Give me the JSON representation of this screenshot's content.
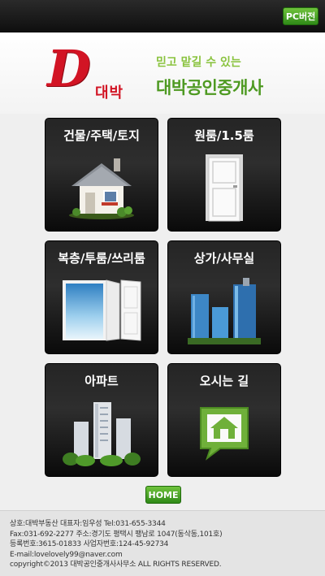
{
  "topbar": {
    "pc_label": "PC버전"
  },
  "header": {
    "logo_letter": "D",
    "logo_word": "대박",
    "tagline": "믿고 맡길 수 있는",
    "company": "대박공인중개사"
  },
  "menu": [
    {
      "label": "건물/주택/토지",
      "icon": "house-icon"
    },
    {
      "label": "원룸/1.5룸",
      "icon": "door-icon"
    },
    {
      "label": "복층/투룸/쓰리룸",
      "icon": "open-door-icon"
    },
    {
      "label": "상가/사무실",
      "icon": "office-buildings-icon"
    },
    {
      "label": "아파트",
      "icon": "apartment-icon"
    },
    {
      "label": "오시는 길",
      "icon": "map-pin-home-icon"
    }
  ],
  "home_label": "HOME",
  "footer": {
    "line1": "상호:대박부동산  대표자:임우성  Tel:031-655-3344",
    "line2": "Fax:031-692-2277  주소:경기도 평택시 팽남로 1047(동삭동,101호)",
    "line3": "등록번호:3615-01833  사업자번호:124-45-92734",
    "line4": "E-mail:lovelovely99@naver.com",
    "line5": "copyright©2013 대박공인중개사사무소  ALL RIGHTS RESERVED."
  },
  "colors": {
    "accent_green": "#4e9a22",
    "logo_red": "#d21424",
    "tile_bg": "#1a1a1a"
  }
}
